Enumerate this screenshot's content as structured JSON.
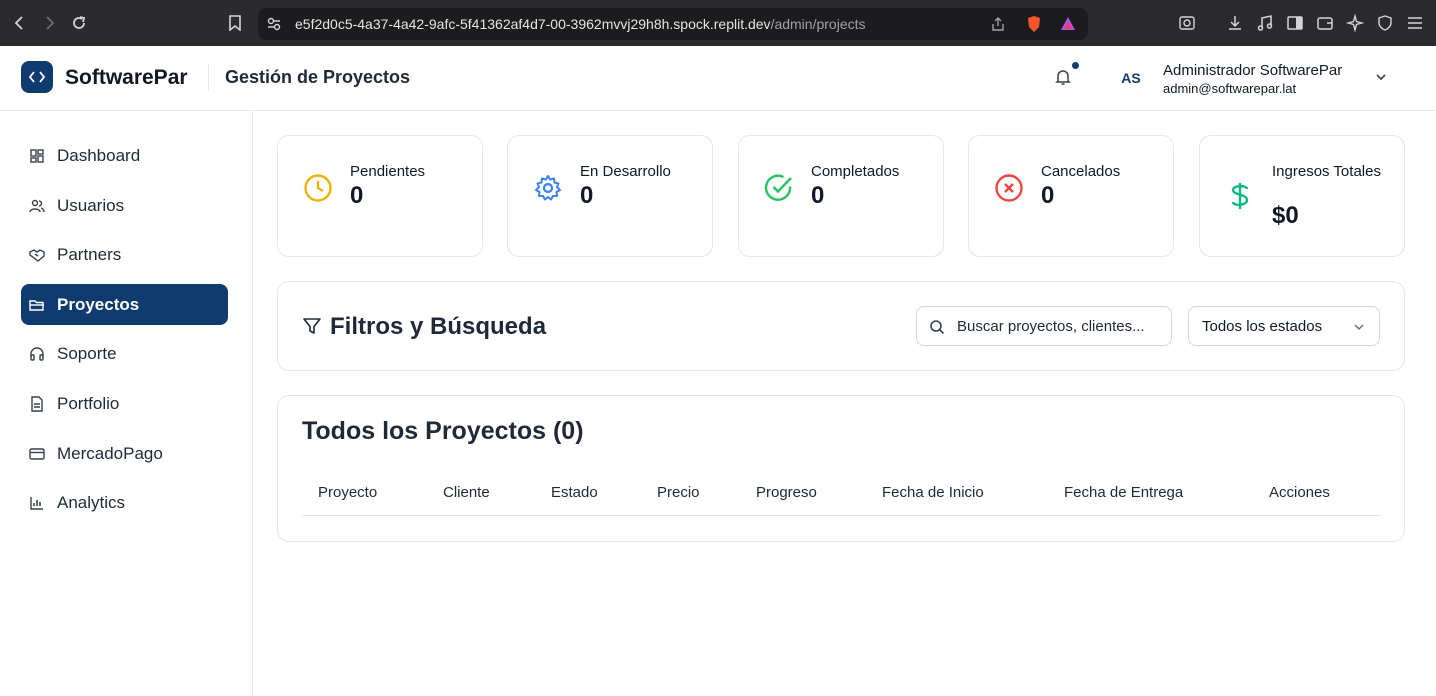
{
  "browser": {
    "url_host": "e5f2d0c5-4a37-4a42-9afc-5f41362af4d7-00-3962mvvj29h8h.spock.replit.dev",
    "url_path": "/admin/projects"
  },
  "header": {
    "brand": "SoftwarePar",
    "page_title": "Gestión de Proyectos",
    "avatar_initials": "AS",
    "user_name": "Administrador SoftwarePar",
    "user_email": "admin@softwarepar.lat"
  },
  "sidebar": {
    "items": [
      {
        "label": "Dashboard",
        "icon": "grid-icon"
      },
      {
        "label": "Usuarios",
        "icon": "users-icon"
      },
      {
        "label": "Partners",
        "icon": "handshake-icon"
      },
      {
        "label": "Proyectos",
        "icon": "folder-icon",
        "active": true
      },
      {
        "label": "Soporte",
        "icon": "headphones-icon"
      },
      {
        "label": "Portfolio",
        "icon": "document-icon"
      },
      {
        "label": "MercadoPago",
        "icon": "credit-card-icon"
      },
      {
        "label": "Analytics",
        "icon": "bar-chart-icon"
      }
    ]
  },
  "stats": [
    {
      "label": "Pendientes",
      "value": "0",
      "icon": "clock-icon",
      "color": "#eab308"
    },
    {
      "label": "En Desarrollo",
      "value": "0",
      "icon": "gear-icon",
      "color": "#3b82f6"
    },
    {
      "label": "Completados",
      "value": "0",
      "icon": "check-circle-icon",
      "color": "#22c55e"
    },
    {
      "label": "Cancelados",
      "value": "0",
      "icon": "x-circle-icon",
      "color": "#ef4444"
    },
    {
      "label": "Ingresos Totales",
      "value": "$0",
      "icon": "dollar-icon",
      "color": "#10b981"
    }
  ],
  "filters": {
    "title": "Filtros y Búsqueda",
    "search_placeholder": "Buscar proyectos, clientes...",
    "status_selected": "Todos los estados"
  },
  "projects_table": {
    "title": "Todos los Proyectos (0)",
    "columns": [
      "Proyecto",
      "Cliente",
      "Estado",
      "Precio",
      "Progreso",
      "Fecha de Inicio",
      "Fecha de Entrega",
      "Acciones"
    ],
    "rows": []
  },
  "colors": {
    "primary": "#0f3b6e",
    "border": "#e5e7eb"
  }
}
